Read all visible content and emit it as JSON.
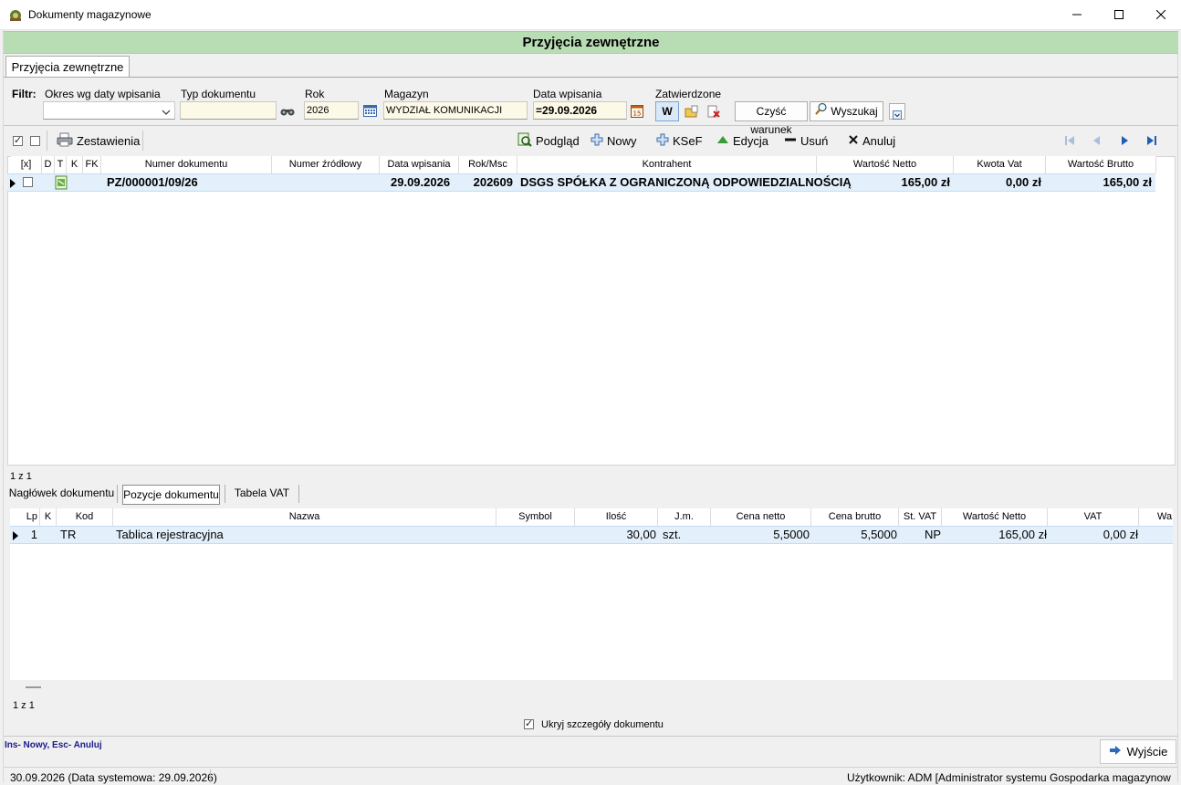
{
  "window": {
    "title": "Dokumenty magazynowe"
  },
  "banner": {
    "title": "Przyjęcia zewnętrzne"
  },
  "main_tab": {
    "label": "Przyjęcia zewnętrzne"
  },
  "filter": {
    "label": "Filtr:",
    "period_label": "Okres wg daty wpisania",
    "period_value": "",
    "doc_type_label": "Typ dokumentu",
    "doc_type_value": "",
    "year_label": "Rok",
    "year_value": "2026",
    "warehouse_label": "Magazyn",
    "warehouse_value": "WYDZIAŁ KOMUNIKACJI",
    "date_label": "Data wpisania",
    "date_value": "=29.09.2026",
    "approved_label": "Zatwierdzone",
    "approved_value": "W",
    "clear_label": "Czyść warunek",
    "search_label": "Wyszukaj"
  },
  "toolbar": {
    "reports_label": "Zestawienia",
    "preview_label": "Podgląd",
    "new_label": "Nowy",
    "ksef_label": "KSeF",
    "edit_label": "Edycja",
    "delete_label": "Usuń",
    "cancel_label": "Anuluj"
  },
  "documents": {
    "columns": [
      "[x]",
      "D",
      "T",
      "K",
      "FK",
      "Numer dokumentu",
      "Numer źródłowy",
      "Data wpisania",
      "Rok/Msc",
      "Kontrahent",
      "Wartość Netto",
      "Kwota Vat",
      "Wartość Brutto"
    ],
    "rows": [
      {
        "number": "PZ/000001/09/26",
        "source_number": "",
        "date": "29.09.2026",
        "year_month": "202609",
        "contractor": "DSGS SPÓŁKA Z OGRANICZONĄ ODPOWIEDZIALNOŚCIĄ",
        "net": "165,00 zł",
        "vat": "0,00 zł",
        "gross": "165,00 zł"
      }
    ],
    "count": "1 z 1"
  },
  "detail_tabs": [
    "Nagłówek dokumentu",
    "Pozycje dokumentu",
    "Tabela VAT"
  ],
  "positions": {
    "columns": [
      "Lp",
      "K",
      "Kod",
      "Nazwa",
      "Symbol",
      "Ilość",
      "J.m.",
      "Cena netto",
      "Cena brutto",
      "St. VAT",
      "Wartość Netto",
      "VAT",
      "Wa"
    ],
    "rows": [
      {
        "lp": "1",
        "k": "",
        "code": "TR",
        "name": "Tablica rejestracyjna",
        "symbol": "",
        "qty": "30,00",
        "unit": "szt.",
        "price_net": "5,5000",
        "price_gross": "5,5000",
        "vat_rate": "NP",
        "net": "165,00 zł",
        "vat": "0,00 zł"
      }
    ],
    "count": "1 z 1"
  },
  "hide_details_label": "Ukryj szczegóły dokumentu",
  "hint": "Ins- Nowy, Esc- Anuluj",
  "exit_label": "Wyjście",
  "status": {
    "date": "30.09.2026 (Data systemowa: 29.09.2026)",
    "user": "Użytkownik: ADM [Administrator systemu Gospodarka magazynow"
  }
}
